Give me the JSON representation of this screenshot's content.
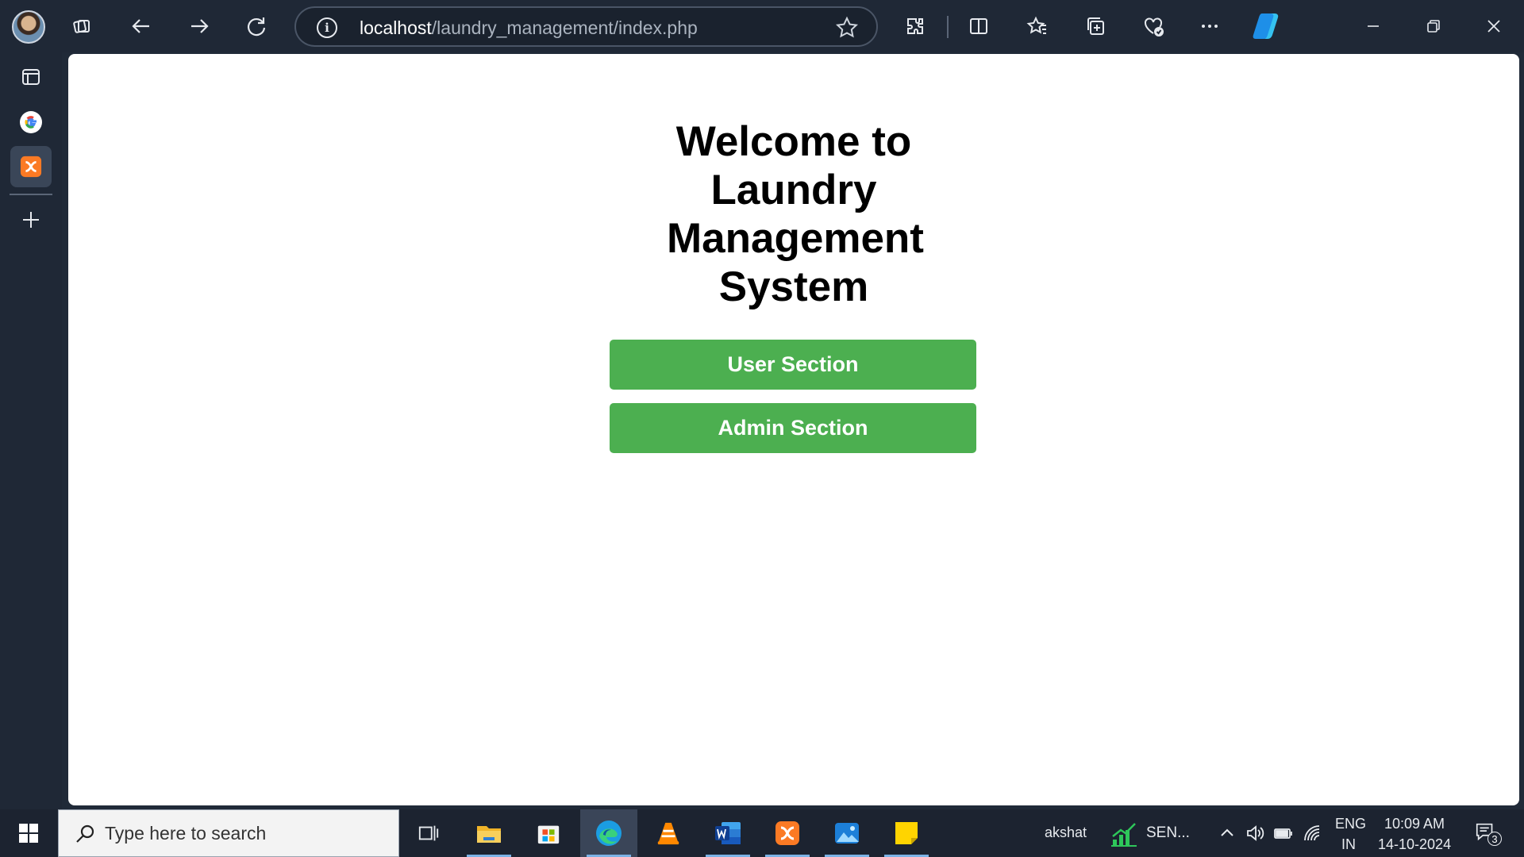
{
  "browser": {
    "address": {
      "host": "localhost",
      "path": "/laundry_management/index.php"
    }
  },
  "page": {
    "title": "Welcome to Laundry Management System",
    "buttons": {
      "user": "User Section",
      "admin": "Admin Section"
    }
  },
  "taskbar": {
    "search_placeholder": "Type here to search",
    "user_label": "akshat",
    "stock_label": "SEN...",
    "lang_top": "ENG",
    "lang_bottom": "IN",
    "time": "10:09 AM",
    "date": "14-10-2024",
    "notification_count": "3"
  },
  "colors": {
    "accent_green": "#4caf50",
    "chrome_bg": "#1f2836"
  }
}
